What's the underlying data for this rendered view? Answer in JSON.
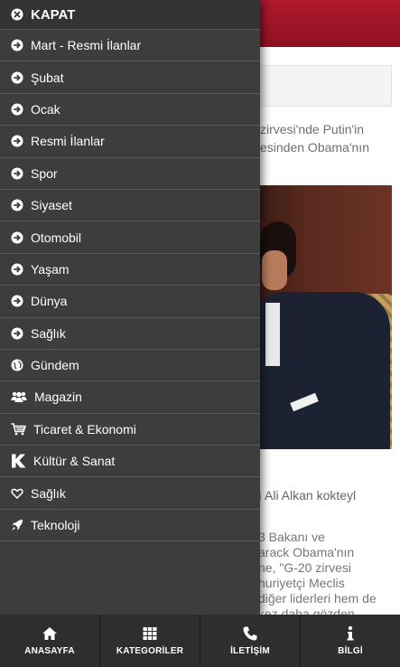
{
  "drawer": {
    "close_label": "KAPAT",
    "items": [
      {
        "label": "Mart - Resmi İlanlar",
        "icon": "arrow-circle-right-icon"
      },
      {
        "label": "Şubat",
        "icon": "arrow-circle-right-icon"
      },
      {
        "label": "Ocak",
        "icon": "arrow-circle-right-icon"
      },
      {
        "label": "Resmi İlanlar",
        "icon": "arrow-circle-right-icon"
      },
      {
        "label": "Spor",
        "icon": "arrow-circle-right-icon"
      },
      {
        "label": "Siyaset",
        "icon": "arrow-circle-right-icon"
      },
      {
        "label": "Otomobil",
        "icon": "arrow-circle-right-icon"
      },
      {
        "label": "Yaşam",
        "icon": "arrow-circle-right-icon"
      },
      {
        "label": "Dünya",
        "icon": "arrow-circle-right-icon"
      },
      {
        "label": "Sağlık",
        "icon": "arrow-circle-right-icon"
      },
      {
        "label": "Gündem",
        "icon": "globe-icon"
      },
      {
        "label": "Magazin",
        "icon": "users-icon"
      },
      {
        "label": "Ticaret & Ekonomi",
        "icon": "cart-icon"
      },
      {
        "label": "Kültür & Sanat",
        "icon": "k-logo-icon"
      },
      {
        "label": "Sağlık",
        "icon": "heart-icon"
      },
      {
        "label": "Teknoloji",
        "icon": "rocket-icon"
      }
    ]
  },
  "background": {
    "lead_line1": "zirvesi'nde Putin'in",
    "lead_line2": "esinden Obama'nın",
    "caption": "ı Ali Alkan kokteyl",
    "body_lines": [
      "3 Bakanı ve",
      "arack Obama'nın",
      "ne, \"G-20 zirvesi",
      "huriyetçi Meclis",
      "diğer liderleri hem de",
      "kez daha gözden"
    ]
  },
  "bottom_nav": {
    "home": "ANASAYFA",
    "categories": "KATEGORİLER",
    "contact": "İLETİŞİM",
    "info": "BİLGİ"
  },
  "colors": {
    "drawer_bg": "#3d3d3d",
    "header_red": "#b0182d",
    "bottom_bar": "#2e2e2e"
  }
}
